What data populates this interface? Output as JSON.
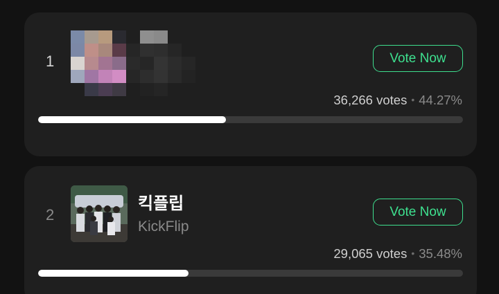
{
  "entries": [
    {
      "rank": "1",
      "name": "",
      "sub_name": "",
      "vote_button_label": "Vote Now",
      "votes_text": "36,266 votes",
      "separator": "•",
      "percent_text": "44.27%",
      "share": 0.4427
    },
    {
      "rank": "2",
      "name": "킥플립",
      "sub_name": "KickFlip",
      "vote_button_label": "Vote Now",
      "votes_text": "29,065 votes",
      "separator": "•",
      "percent_text": "35.48%",
      "share": 0.3548
    }
  ],
  "colors": {
    "accent": "#3ee08f",
    "card_bg": "#1f1f1f",
    "page_bg": "#121212",
    "bar_fill": "#ffffff",
    "bar_track": "#3a3a3a"
  }
}
